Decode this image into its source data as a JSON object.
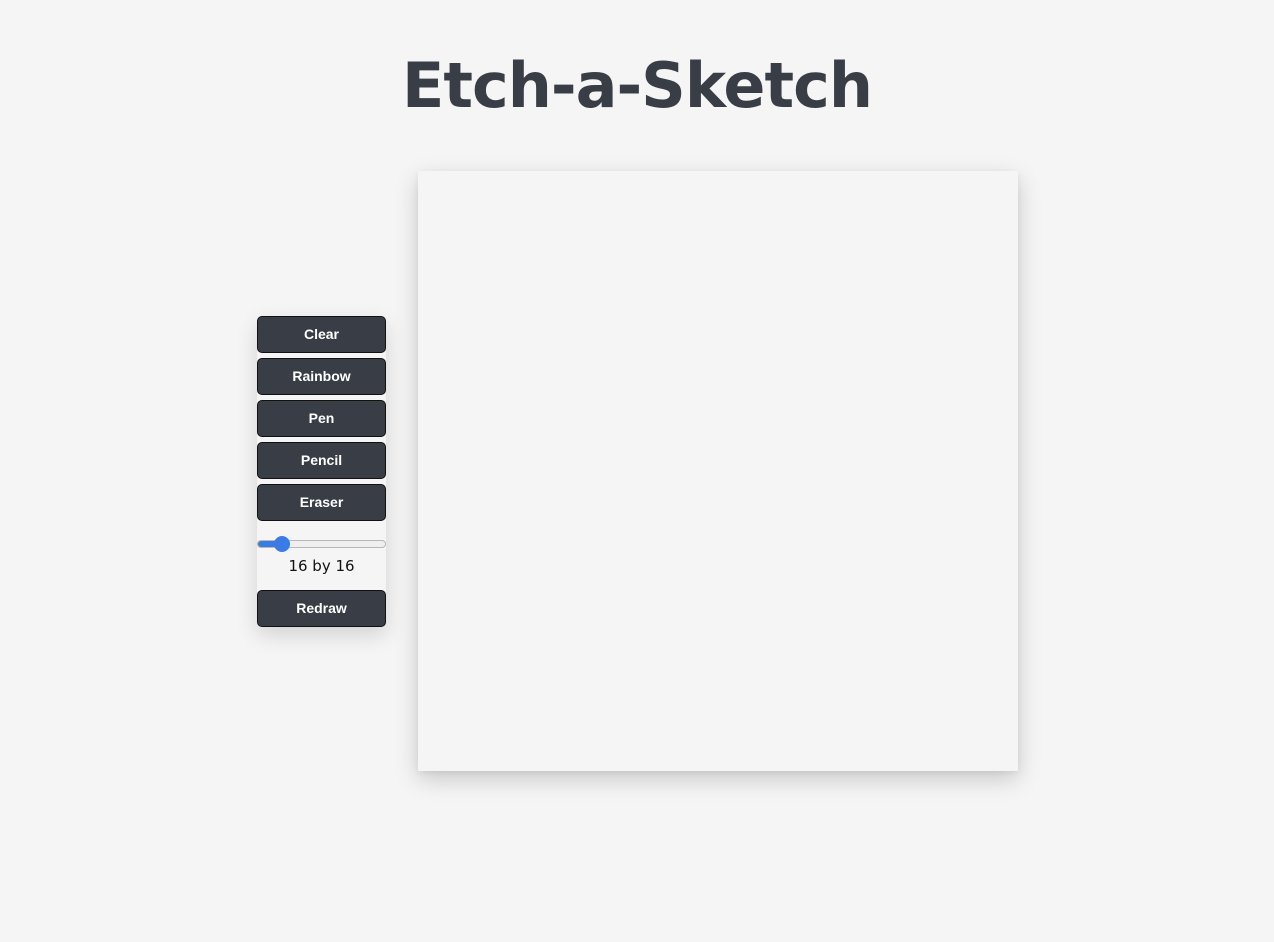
{
  "header": {
    "title": "Etch-a-Sketch"
  },
  "controls": {
    "clear_label": "Clear",
    "rainbow_label": "Rainbow",
    "pen_label": "Pen",
    "pencil_label": "Pencil",
    "eraser_label": "Eraser",
    "redraw_label": "Redraw",
    "grid_size_slider": {
      "value": 16,
      "min": 1,
      "max": 100,
      "accent_color": "#3b7be6"
    },
    "grid_size_text": "16 by 16"
  },
  "colors": {
    "background": "#f5f5f5",
    "button_background": "#393e46",
    "button_text": "#ffffff",
    "title_text": "#393e46"
  }
}
